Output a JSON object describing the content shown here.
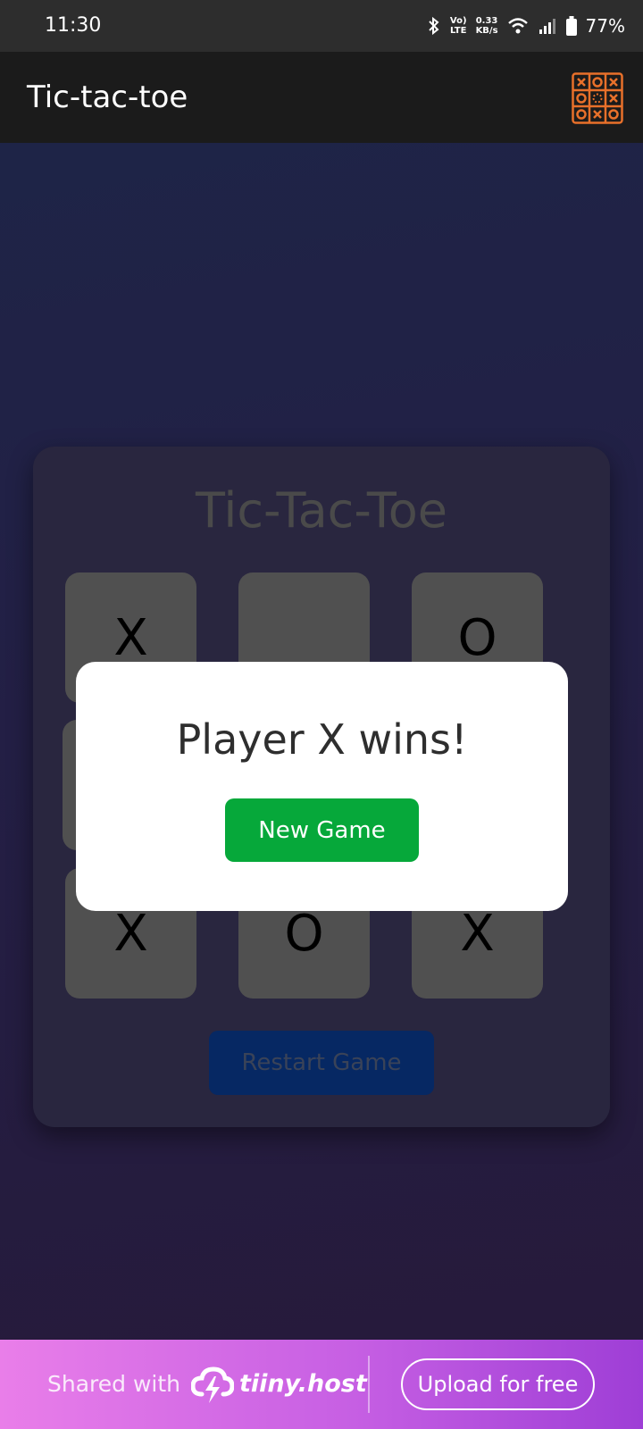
{
  "status_bar": {
    "time": "11:30",
    "network_label_top": "Vo)",
    "network_label_bottom": "LTE",
    "speed_value": "0.33",
    "speed_unit": "KB/s",
    "battery": "77%",
    "icons": [
      "bluetooth-icon",
      "volte-icon",
      "wifi-icon",
      "signal-icon",
      "battery-icon"
    ]
  },
  "app_bar": {
    "title": "Tic-tac-toe",
    "logo_icon": "tic-tac-toe-grid-icon",
    "logo_color": "#e8702a"
  },
  "game": {
    "title": "Tic-Tac-Toe",
    "board": [
      [
        "X",
        "",
        "O"
      ],
      [
        "",
        "",
        ""
      ],
      [
        "X",
        "O",
        "X"
      ]
    ],
    "restart_label": "Restart Game"
  },
  "modal": {
    "message": "Player X wins!",
    "button_label": "New Game",
    "button_color": "#06a83a"
  },
  "footer": {
    "shared_text": "Shared with",
    "brand": "tiiny.host",
    "upload_label": "Upload for free"
  }
}
